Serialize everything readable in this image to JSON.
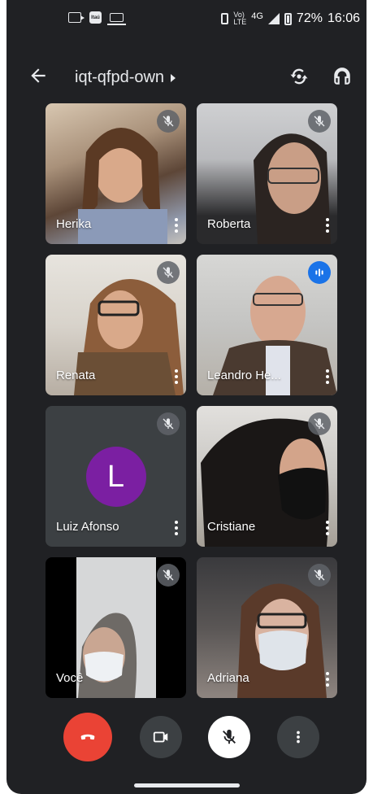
{
  "status_bar": {
    "network_label_top": "Vo)",
    "network_label_bottom": "LTE",
    "network_type": "4G",
    "battery": "72%",
    "time": "16:06",
    "itau_label": "Itaú"
  },
  "header": {
    "meeting_code": "iqt-qfpd-own"
  },
  "participants": [
    {
      "name": "Herika",
      "muted": true,
      "speaking": false
    },
    {
      "name": "Roberta",
      "muted": true,
      "speaking": false
    },
    {
      "name": "Renata",
      "muted": true,
      "speaking": false
    },
    {
      "name": "Leandro He...",
      "muted": false,
      "speaking": true
    },
    {
      "name": "Luiz Afonso",
      "muted": true,
      "speaking": false,
      "avatar_letter": "L",
      "avatar_color": "#7b1fa2"
    },
    {
      "name": "Cristiane",
      "muted": true,
      "speaking": false
    },
    {
      "name": "Você",
      "muted": true,
      "speaking": false
    },
    {
      "name": "Adriana",
      "muted": true,
      "speaking": false
    }
  ],
  "controls": {
    "end_call_color": "#ea4335",
    "icons": [
      "end-call-icon",
      "video-camera-icon",
      "mic-off-icon",
      "more-vert-icon"
    ]
  },
  "colors": {
    "background": "#202124",
    "tile_empty": "#3c4043",
    "speaking_accent": "#1a73e8"
  }
}
